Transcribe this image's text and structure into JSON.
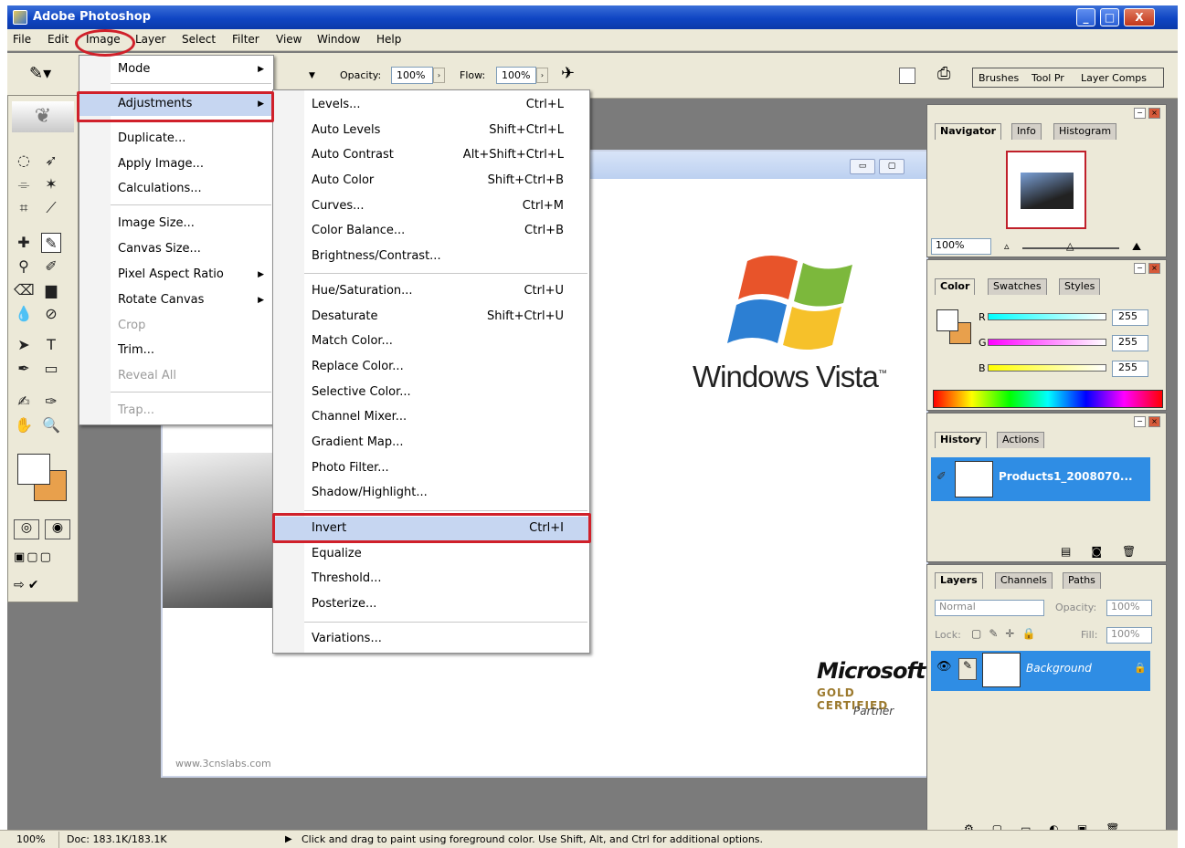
{
  "window": {
    "title": "Adobe Photoshop",
    "buttons": [
      "_",
      "□",
      "X"
    ]
  },
  "menubar": [
    "File",
    "Edit",
    "Image",
    "Layer",
    "Select",
    "Filter",
    "View",
    "Window",
    "Help"
  ],
  "options_bar": {
    "opacity_label": "Opacity:",
    "opacity_value": "100%",
    "flow_label": "Flow:",
    "flow_value": "100%",
    "panel_well_tabs": [
      "Brushes",
      "Tool Pr",
      "Layer Comps"
    ]
  },
  "image_menu": {
    "items": [
      {
        "label": "Mode",
        "submenu": true,
        "disabled": false
      },
      {
        "label": "Adjustments",
        "submenu": true,
        "disabled": false
      },
      {
        "label": "Duplicate...",
        "disabled": false
      },
      {
        "label": "Apply Image...",
        "disabled": false
      },
      {
        "label": "Calculations...",
        "disabled": false
      },
      {
        "label": "Image Size...",
        "disabled": false
      },
      {
        "label": "Canvas Size...",
        "disabled": false
      },
      {
        "label": "Pixel Aspect Ratio",
        "submenu": true,
        "disabled": false
      },
      {
        "label": "Rotate Canvas",
        "submenu": true,
        "disabled": false
      },
      {
        "label": "Crop",
        "disabled": true
      },
      {
        "label": "Trim...",
        "disabled": false
      },
      {
        "label": "Reveal All",
        "disabled": true
      },
      {
        "label": "Trap...",
        "disabled": true
      }
    ]
  },
  "adjustments_menu": {
    "items": [
      {
        "label": "Levels...",
        "shortcut": "Ctrl+L"
      },
      {
        "label": "Auto Levels",
        "shortcut": "Shift+Ctrl+L"
      },
      {
        "label": "Auto Contrast",
        "shortcut": "Alt+Shift+Ctrl+L"
      },
      {
        "label": "Auto Color",
        "shortcut": "Shift+Ctrl+B"
      },
      {
        "label": "Curves...",
        "shortcut": "Ctrl+M"
      },
      {
        "label": "Color Balance...",
        "shortcut": "Ctrl+B"
      },
      {
        "label": "Brightness/Contrast...",
        "shortcut": ""
      },
      {
        "label": "Hue/Saturation...",
        "shortcut": "Ctrl+U"
      },
      {
        "label": "Desaturate",
        "shortcut": "Shift+Ctrl+U"
      },
      {
        "label": "Match Color...",
        "shortcut": ""
      },
      {
        "label": "Replace Color...",
        "shortcut": ""
      },
      {
        "label": "Selective Color...",
        "shortcut": ""
      },
      {
        "label": "Channel Mixer...",
        "shortcut": ""
      },
      {
        "label": "Gradient Map...",
        "shortcut": ""
      },
      {
        "label": "Photo Filter...",
        "shortcut": ""
      },
      {
        "label": "Shadow/Highlight...",
        "shortcut": ""
      },
      {
        "label": "Invert",
        "shortcut": "Ctrl+I"
      },
      {
        "label": "Equalize",
        "shortcut": ""
      },
      {
        "label": "Threshold...",
        "shortcut": ""
      },
      {
        "label": "Posterize...",
        "shortcut": ""
      },
      {
        "label": "Variations...",
        "shortcut": ""
      }
    ]
  },
  "document": {
    "logo_text": "Windows Vista",
    "trademark": "™",
    "ms_brand": "Microsoft",
    "ms_cert": "GOLD CERTIFIED",
    "ms_partner": "Partner",
    "watermark": "www.3cnslabs.com"
  },
  "navigator_panel": {
    "tabs": [
      "Navigator",
      "Info",
      "Histogram"
    ],
    "zoom": "100%"
  },
  "color_panel": {
    "tabs": [
      "Color",
      "Swatches",
      "Styles"
    ],
    "channels": [
      {
        "label": "R",
        "value": "255"
      },
      {
        "label": "G",
        "value": "255"
      },
      {
        "label": "B",
        "value": "255"
      }
    ]
  },
  "history_panel": {
    "tabs": [
      "History",
      "Actions"
    ],
    "snapshot": "Products1_2008070..."
  },
  "layers_panel": {
    "tabs": [
      "Layers",
      "Channels",
      "Paths"
    ],
    "blend_mode": "Normal",
    "opacity_label": "Opacity:",
    "opacity_value": "100%",
    "lock_label": "Lock:",
    "fill_label": "Fill:",
    "fill_value": "100%",
    "layer_name": "Background"
  },
  "status_bar": {
    "zoom": "100%",
    "doc": "Doc: 183.1K/183.1K",
    "hint": "Click and drag to paint using foreground color.  Use Shift, Alt, and Ctrl for additional options."
  }
}
